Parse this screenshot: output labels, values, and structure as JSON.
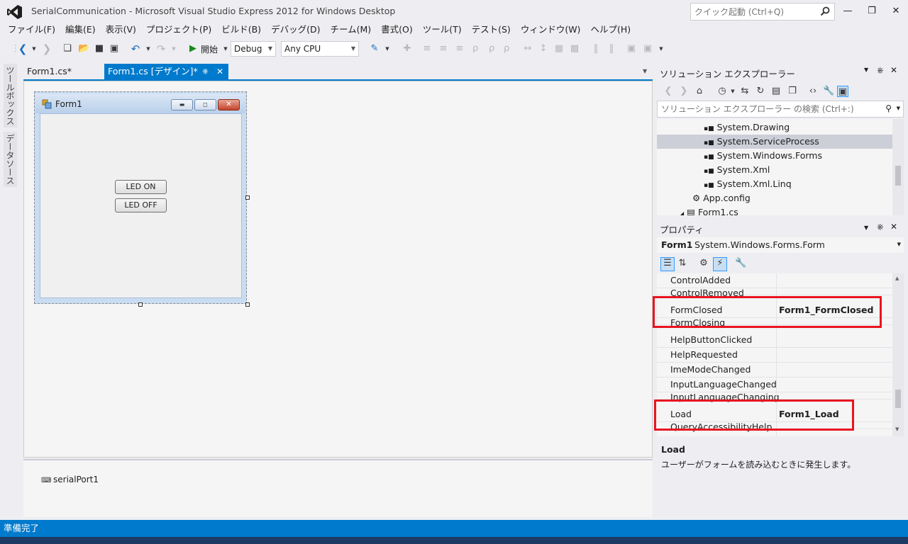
{
  "window": {
    "title": "SerialCommunication - Microsoft Visual Studio Express 2012 for Windows Desktop",
    "quick_launch_placeholder": "クイック起動 (Ctrl+Q)"
  },
  "menu": [
    "ファイル(F)",
    "編集(E)",
    "表示(V)",
    "プロジェクト(P)",
    "ビルド(B)",
    "デバッグ(D)",
    "チーム(M)",
    "書式(O)",
    "ツール(T)",
    "テスト(S)",
    "ウィンドウ(W)",
    "ヘルプ(H)"
  ],
  "toolbar": {
    "start_label": "開始",
    "config": "Debug",
    "platform": "Any CPU"
  },
  "left_tabs": [
    "ツールボックス",
    "データソース"
  ],
  "doc_tabs": {
    "code_tab": "Form1.cs*",
    "design_tab": "Form1.cs [デザイン]*"
  },
  "form": {
    "title": "Form1",
    "button_on": "LED ON",
    "button_off": "LED OFF"
  },
  "component_tray": {
    "item": "serialPort1"
  },
  "solution_explorer": {
    "title": "ソリューション エクスプローラー",
    "search_placeholder": "ソリューション エクスプローラー の検索 (Ctrl+:)",
    "items": [
      {
        "label": "System.Drawing",
        "selected": false
      },
      {
        "label": "System.ServiceProcess",
        "selected": true
      },
      {
        "label": "System.Windows.Forms",
        "selected": false
      },
      {
        "label": "System.Xml",
        "selected": false
      },
      {
        "label": "System.Xml.Linq",
        "selected": false
      },
      {
        "label": "App.config",
        "selected": false
      },
      {
        "label": "Form1.cs",
        "selected": false
      }
    ]
  },
  "properties": {
    "title": "プロパティ",
    "object_name": "Form1",
    "object_type": "System.Windows.Forms.Form",
    "rows": [
      {
        "name": "ControlAdded",
        "value": ""
      },
      {
        "name": "ControlRemoved",
        "value": ""
      },
      {
        "name": "FormClosed",
        "value": "Form1_FormClosed"
      },
      {
        "name": "FormClosing",
        "value": ""
      },
      {
        "name": "HelpButtonClicked",
        "value": ""
      },
      {
        "name": "HelpRequested",
        "value": ""
      },
      {
        "name": "ImeModeChanged",
        "value": ""
      },
      {
        "name": "InputLanguageChanged",
        "value": ""
      },
      {
        "name": "InputLanguageChanging",
        "value": ""
      },
      {
        "name": "Load",
        "value": "Form1_Load"
      },
      {
        "name": "QueryAccessibilityHelp",
        "value": ""
      }
    ],
    "description_name": "Load",
    "description_text": "ユーザーがフォームを読み込むときに発生します。"
  },
  "status": {
    "text": "準備完了"
  },
  "colors": {
    "accent": "#007acc",
    "highlight_box": "#e8151f"
  }
}
